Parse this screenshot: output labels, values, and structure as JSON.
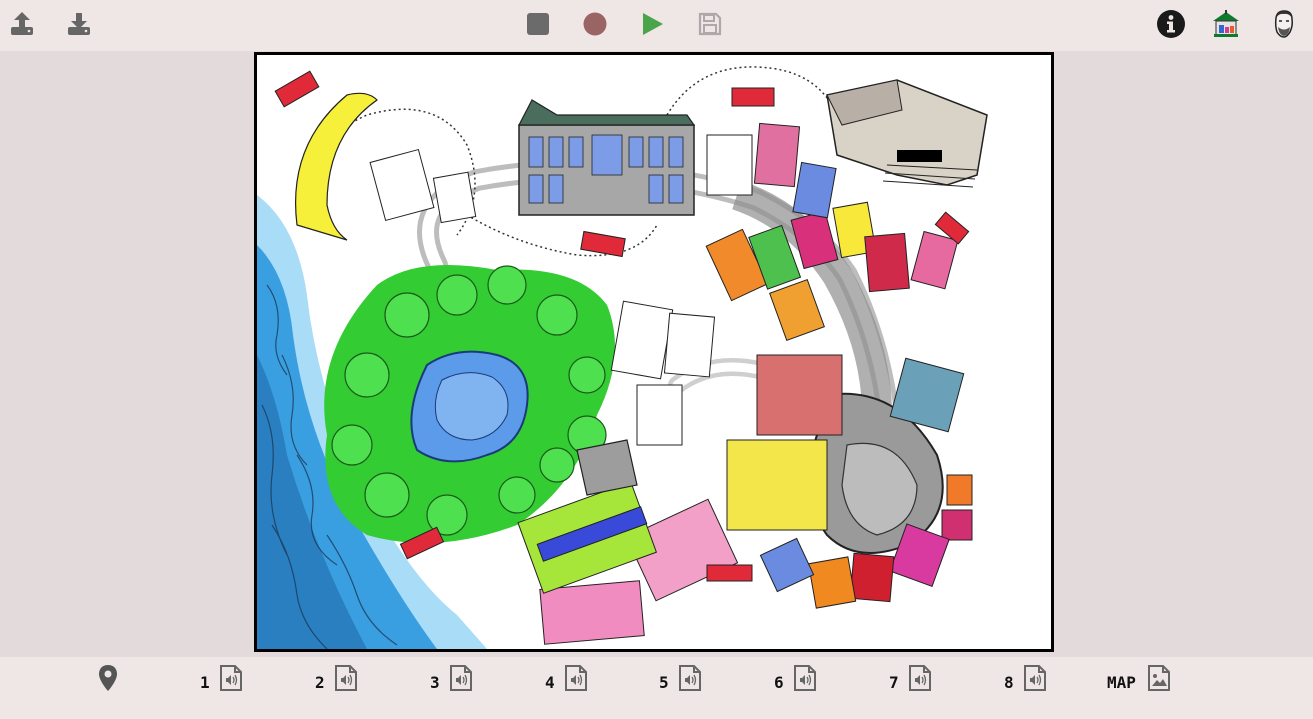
{
  "toolbar": {
    "left": [
      {
        "name": "upload-button",
        "icon": "upload-icon"
      },
      {
        "name": "download-button",
        "icon": "download-icon"
      }
    ],
    "center": [
      {
        "name": "stop-button",
        "icon": "stop-icon",
        "color": "#6b6b6b"
      },
      {
        "name": "record-button",
        "icon": "record-icon",
        "color": "#9b6464"
      },
      {
        "name": "play-button",
        "icon": "play-icon",
        "color": "#4aa44a"
      },
      {
        "name": "save-button",
        "icon": "save-icon",
        "color": "#b0a8a8",
        "disabled": true
      }
    ],
    "right": [
      {
        "name": "info-button",
        "icon": "info-icon"
      },
      {
        "name": "kiosk-button",
        "icon": "kiosk-icon"
      },
      {
        "name": "profile-button",
        "icon": "avatar-icon"
      }
    ]
  },
  "map": {
    "description_icon": "illustrated-city-map-image",
    "colors": {
      "water": "#3a9fe0",
      "park": "#33cc33",
      "lake": "#5b9bea",
      "road": "#9a9a9a"
    }
  },
  "bottom": {
    "location_icon": "map-pin-icon",
    "slots": [
      {
        "label": "1",
        "icon": "audio-file-icon"
      },
      {
        "label": "2",
        "icon": "audio-file-icon"
      },
      {
        "label": "3",
        "icon": "audio-file-icon"
      },
      {
        "label": "4",
        "icon": "audio-file-icon"
      },
      {
        "label": "5",
        "icon": "audio-file-icon"
      },
      {
        "label": "6",
        "icon": "audio-file-icon"
      },
      {
        "label": "7",
        "icon": "audio-file-icon"
      },
      {
        "label": "8",
        "icon": "audio-file-icon"
      }
    ],
    "map_slot": {
      "label": "MAP",
      "icon": "image-file-icon"
    }
  }
}
